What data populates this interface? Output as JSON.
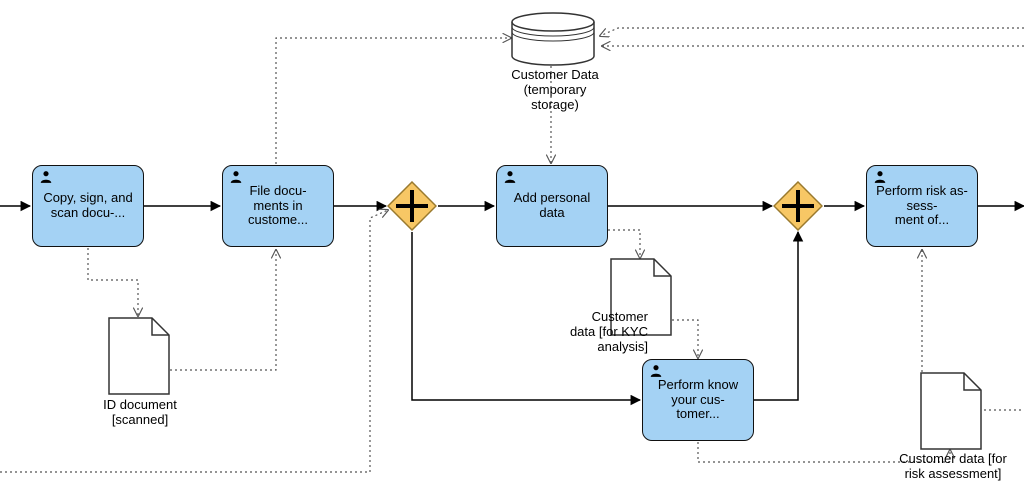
{
  "tasks": {
    "copy_sign_scan": "Copy, sign, and scan docu-...",
    "file_documents": "File docu-\nments in custome...",
    "add_personal_data": "Add personal data",
    "perform_kyc": "Perform know your cus-\ntomer...",
    "perform_risk": "Perform risk as-\nsess-\nment of..."
  },
  "artifacts": {
    "id_document_scanned": "ID document [scanned]",
    "customer_data_kyc": "Customer data [for KYC analysis]",
    "customer_data_risk": "Customer data [for risk assessment]"
  },
  "data_store": {
    "customer_data_temp": "Customer Data (temporary storage)"
  },
  "chart_data": {
    "type": "bpmn-process-diagram",
    "nodes": [
      {
        "id": "t1",
        "type": "user-task",
        "label": "Copy, sign, and scan docu-..."
      },
      {
        "id": "t2",
        "type": "user-task",
        "label": "File docu-ments in custome..."
      },
      {
        "id": "g1",
        "type": "parallel-gateway"
      },
      {
        "id": "t3",
        "type": "user-task",
        "label": "Add personal data"
      },
      {
        "id": "t4",
        "type": "user-task",
        "label": "Perform know your cus-tomer..."
      },
      {
        "id": "g2",
        "type": "parallel-gateway"
      },
      {
        "id": "t5",
        "type": "user-task",
        "label": "Perform risk as-sess-ment of..."
      },
      {
        "id": "d1",
        "type": "data-object",
        "label": "ID document [scanned]"
      },
      {
        "id": "d2",
        "type": "data-object",
        "label": "Customer data [for KYC analysis]"
      },
      {
        "id": "d3",
        "type": "data-object",
        "label": "Customer data [for risk assessment]"
      },
      {
        "id": "ds1",
        "type": "data-store",
        "label": "Customer Data (temporary storage)"
      }
    ],
    "sequence_flows": [
      {
        "from": "start-offscreen-left",
        "to": "t1"
      },
      {
        "from": "t1",
        "to": "t2"
      },
      {
        "from": "t2",
        "to": "g1"
      },
      {
        "from": "g1",
        "to": "t3"
      },
      {
        "from": "g1",
        "to": "t4"
      },
      {
        "from": "t3",
        "to": "g2"
      },
      {
        "from": "t4",
        "to": "g2"
      },
      {
        "from": "g2",
        "to": "t5"
      },
      {
        "from": "t5",
        "to": "end-offscreen-right"
      }
    ],
    "data_associations": [
      {
        "from": "t1",
        "to": "d1"
      },
      {
        "from": "d1",
        "to": "t2"
      },
      {
        "from": "t2",
        "to": "ds1"
      },
      {
        "from": "ds1",
        "to": "t3"
      },
      {
        "from": "t3",
        "to": "d2"
      },
      {
        "from": "d2",
        "to": "t4"
      },
      {
        "from": "t4",
        "to": "d3"
      },
      {
        "from": "d3",
        "to": "t5"
      },
      {
        "from": "offscreen-left-bottom",
        "to": "g1"
      },
      {
        "from": "offscreen-right-top",
        "to": "ds1"
      },
      {
        "from": "d3",
        "to": "offscreen-right"
      }
    ]
  }
}
